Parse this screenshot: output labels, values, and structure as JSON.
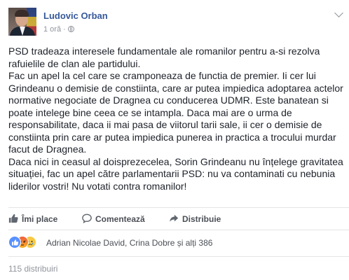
{
  "post": {
    "author": "Ludovic Orban",
    "timestamp": "1 oră",
    "privacy_icon": "globe-icon",
    "paragraphs": [
      "PSD tradeaza interesele fundamentale ale romanilor pentru a-si rezolva rafuielile de clan ale partidului.",
      "Fac un apel la cel care se cramponeaza de functia de premier. Ii cer lui Grindeanu o demisie de constiinta, care ar putea impiedica adoptarea actelor normative negociate de Dragnea cu conducerea UDMR. Este banatean si poate intelege bine ceea ce se intampla. Daca mai are o urma de responsabilitate, daca ii mai pasa de viitorul tarii sale, ii cer o demisie de constiinta prin care ar putea impiedica punerea in practica a trocului murdar facut de Dragnea.",
      "Daca nici in ceasul al doisprezecelea, Sorin Grindeanu nu înțelege gravitatea situației, fac un apel către parlamentarii PSD: nu va contaminati cu nebunia liderilor vostri! Nu votati contra romanilor!"
    ]
  },
  "actions": {
    "like_label": "Îmi place",
    "comment_label": "Comentează",
    "share_label": "Distribuie"
  },
  "reactions": {
    "icons": [
      "like-icon",
      "angry-icon",
      "sad-icon"
    ],
    "summary": "Adrian Nicolae David, Crina Dobre și alți 386"
  },
  "shares": {
    "label": "115 distribuiri"
  },
  "colors": {
    "link": "#365899",
    "text": "#1d2129",
    "muted": "#90949c",
    "action": "#4b4f56",
    "like_blue": "#5890ff"
  }
}
